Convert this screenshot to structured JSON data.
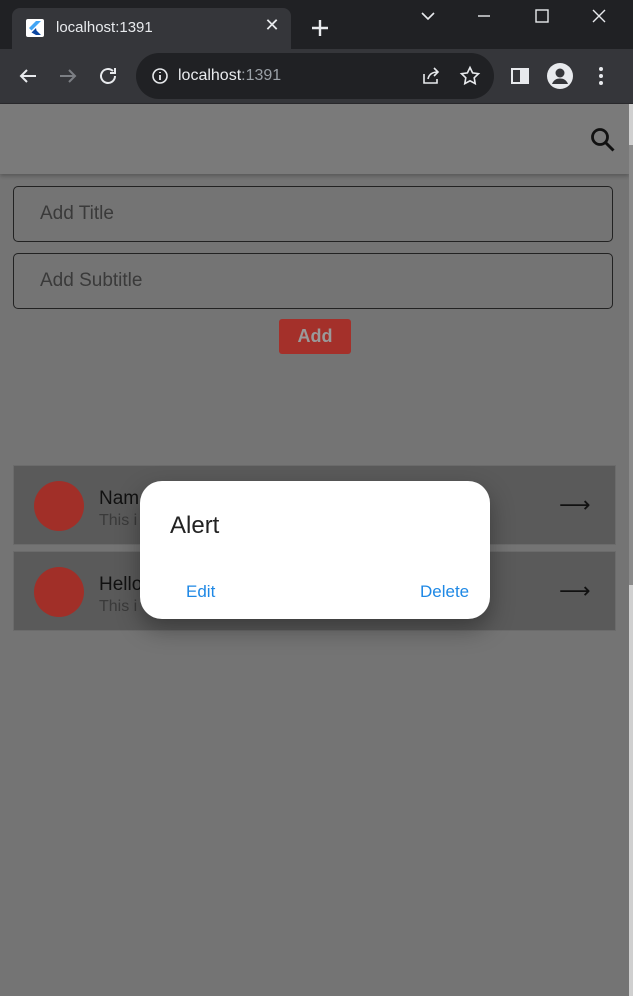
{
  "browser": {
    "tab_title": "localhost:1391",
    "url_host": "localhost",
    "url_port": ":1391"
  },
  "form": {
    "title_placeholder": "Add Title",
    "subtitle_placeholder": "Add Subtitle",
    "add_label": "Add"
  },
  "list": {
    "items": [
      {
        "title": "Nam",
        "subtitle": "This i",
        "arrow": "⟶"
      },
      {
        "title": "Hello",
        "subtitle": "This i",
        "arrow": "⟶"
      }
    ]
  },
  "dialog": {
    "title": "Alert",
    "edit_label": "Edit",
    "delete_label": "Delete"
  },
  "colors": {
    "accent_red": "#a4302a",
    "dialog_button": "#1e88e5",
    "overlay": "#747474"
  }
}
